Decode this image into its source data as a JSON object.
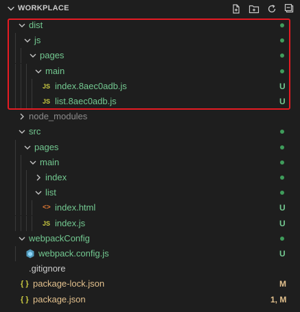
{
  "colors": {
    "green_text": "#73c991",
    "yellow_text": "#e2c08d",
    "default_text": "#cccccc",
    "dim_text": "#8c8c8c",
    "dot_color": "#3f9c5b",
    "js_icon": "#cbcb41",
    "html_icon": "#e37933",
    "json_icon": "#cbcb41",
    "webpack_icon": "#519aba",
    "highlight": "#e81b23"
  },
  "header": {
    "title": "WORKPLACE",
    "actions": [
      "new-file-icon",
      "new-folder-icon",
      "refresh-icon",
      "collapse-all-icon"
    ]
  },
  "tree": [
    {
      "label": "dist",
      "depth": 0,
      "type": "folder",
      "open": true,
      "status": "dot"
    },
    {
      "label": "js",
      "depth": 1,
      "type": "folder",
      "open": true,
      "status": "dot"
    },
    {
      "label": "pages",
      "depth": 2,
      "type": "folder",
      "open": true,
      "status": "dot"
    },
    {
      "label": "main",
      "depth": 3,
      "type": "folder",
      "open": true,
      "status": "dot"
    },
    {
      "label": "index.8aec0adb.js",
      "depth": 4,
      "type": "js",
      "icon_text": "JS",
      "status": "U"
    },
    {
      "label": "list.8aec0adb.js",
      "depth": 4,
      "type": "js",
      "icon_text": "JS",
      "status": "U"
    },
    {
      "label": "node_modules",
      "depth": 0,
      "type": "folder",
      "open": false,
      "status": "none"
    },
    {
      "label": "src",
      "depth": 0,
      "type": "folder",
      "open": true,
      "status": "dot"
    },
    {
      "label": "pages",
      "depth": 1,
      "type": "folder",
      "open": true,
      "status": "dot"
    },
    {
      "label": "main",
      "depth": 2,
      "type": "folder",
      "open": true,
      "status": "dot"
    },
    {
      "label": "index",
      "depth": 3,
      "type": "folder",
      "open": false,
      "status": "dot"
    },
    {
      "label": "list",
      "depth": 3,
      "type": "folder",
      "open": true,
      "status": "dot"
    },
    {
      "label": "index.html",
      "depth": 4,
      "type": "html",
      "icon_text": "<>",
      "status": "U"
    },
    {
      "label": "index.js",
      "depth": 4,
      "type": "js",
      "icon_text": "JS",
      "status": "U"
    },
    {
      "label": "webpackConfig",
      "depth": 0,
      "type": "folder",
      "open": true,
      "status": "dot"
    },
    {
      "label": "webpack.config.js",
      "depth": 1,
      "type": "webpack",
      "icon_text": "",
      "status": "U"
    },
    {
      "label": ".gitignore",
      "depth": 0,
      "type": "gitignore",
      "icon_text": "",
      "status": "none"
    },
    {
      "label": "package-lock.json",
      "depth": 0,
      "type": "json",
      "icon_text": "{ }",
      "status": "M"
    },
    {
      "label": "package.json",
      "depth": 0,
      "type": "json",
      "icon_text": "{ }",
      "status": "1, M"
    }
  ]
}
